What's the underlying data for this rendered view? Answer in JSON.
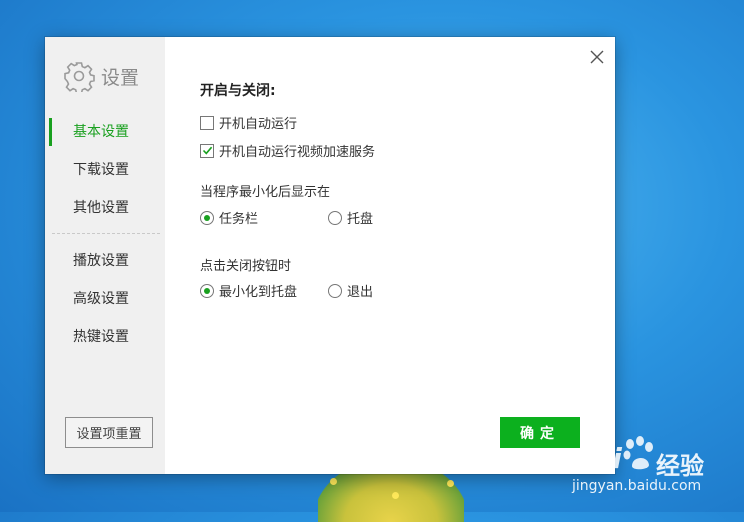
{
  "sidebar": {
    "title": "设置",
    "items": [
      {
        "label": "基本设置",
        "active": true
      },
      {
        "label": "下载设置",
        "active": false
      },
      {
        "label": "其他设置",
        "active": false
      },
      {
        "label": "播放设置",
        "active": false
      },
      {
        "label": "高级设置",
        "active": false
      },
      {
        "label": "热键设置",
        "active": false
      }
    ],
    "reset_label": "设置项重置"
  },
  "main": {
    "section_title": "开启与关闭:",
    "checkboxes": [
      {
        "label": "开机自动运行",
        "checked": false
      },
      {
        "label": "开机自动运行视频加速服务",
        "checked": true
      }
    ],
    "minimize_group": {
      "label": "当程序最小化后显示在",
      "options": [
        {
          "label": "任务栏",
          "selected": true
        },
        {
          "label": "托盘",
          "selected": false
        }
      ]
    },
    "close_group": {
      "label": "点击关闭按钮时",
      "options": [
        {
          "label": "最小化到托盘",
          "selected": true
        },
        {
          "label": "退出",
          "selected": false
        }
      ]
    },
    "confirm_label": "确定"
  },
  "colors": {
    "accent": "#19a01f",
    "confirm_button": "#0cb01e"
  },
  "watermark": {
    "logo": "Bai",
    "text": "经验",
    "url": "jingyan.baidu.com"
  }
}
